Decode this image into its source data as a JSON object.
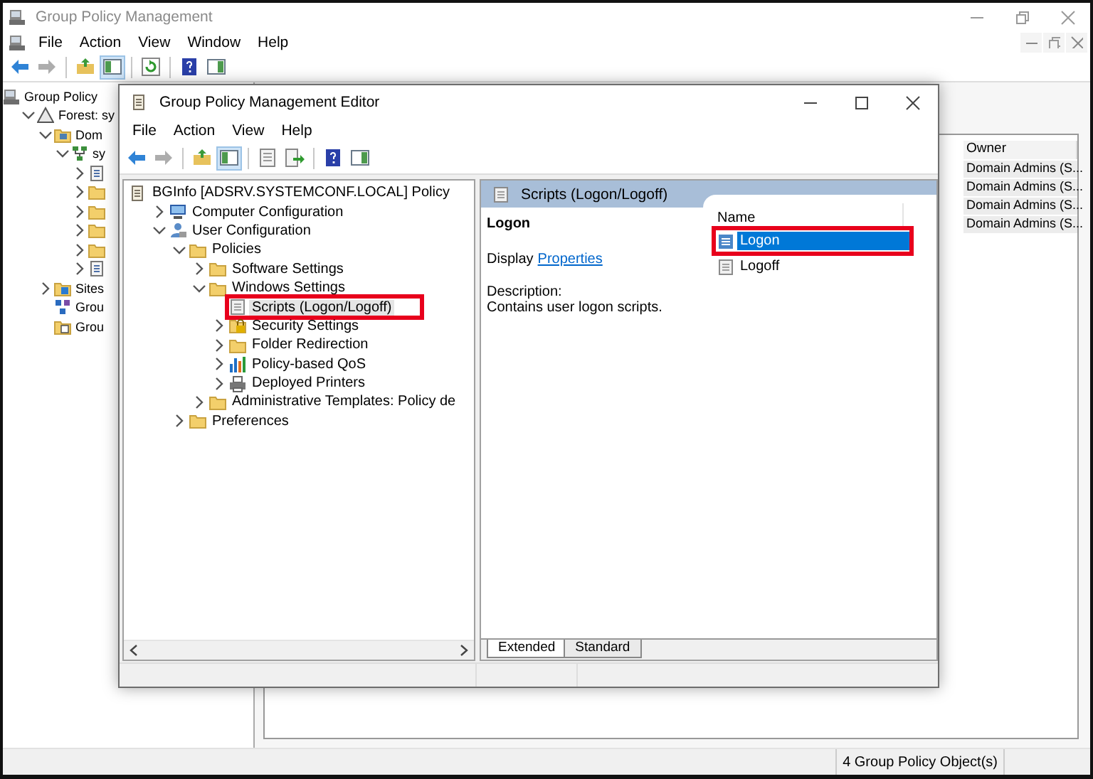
{
  "main_window": {
    "title": "Group Policy Management",
    "menu": [
      "File",
      "Action",
      "View",
      "Window",
      "Help"
    ],
    "toolbar": [
      {
        "kind": "back",
        "disabled": false,
        "on": false
      },
      {
        "kind": "forward",
        "disabled": true,
        "on": false
      },
      {
        "kind": "separator"
      },
      {
        "kind": "up",
        "disabled": false,
        "on": false
      },
      {
        "kind": "tree",
        "disabled": false,
        "on": true
      },
      {
        "kind": "separator"
      },
      {
        "kind": "refresh",
        "disabled": false,
        "on": false
      },
      {
        "kind": "separator"
      },
      {
        "kind": "help",
        "disabled": false,
        "on": false
      },
      {
        "kind": "view",
        "disabled": false,
        "on": false
      }
    ],
    "tree": [
      {
        "label": "Group Policy",
        "kind": "console",
        "children": [
          {
            "label": "Forest: sy",
            "kind": "forest",
            "expanded": true,
            "children": [
              {
                "label": "Dom",
                "kind": "domains",
                "expanded": true,
                "children": [
                  {
                    "label": "sy",
                    "kind": "domain",
                    "expanded": true,
                    "children": [
                      {
                        "kind": "gpo",
                        "expanded": false
                      },
                      {
                        "kind": "folder",
                        "expanded": false
                      },
                      {
                        "kind": "folder",
                        "expanded": false
                      },
                      {
                        "kind": "folder",
                        "expanded": false
                      },
                      {
                        "kind": "folder",
                        "expanded": false
                      },
                      {
                        "kind": "gpo",
                        "expanded": false
                      }
                    ]
                  }
                ]
              },
              {
                "label": "Sites",
                "kind": "sites",
                "expanded": false
              },
              {
                "label": "Grou",
                "kind": "modeling"
              },
              {
                "label": "Grou",
                "kind": "results"
              }
            ]
          }
        ]
      }
    ],
    "table": {
      "columns": [
        "Owner"
      ],
      "rows": [
        [
          "Domain Admins (S..."
        ],
        [
          "Domain Admins (S..."
        ],
        [
          "Domain Admins (S..."
        ],
        [
          "Domain Admins (S..."
        ]
      ]
    },
    "status_bar": "4 Group Policy Object(s)"
  },
  "editor_window": {
    "title": "Group Policy Management Editor",
    "menu": [
      "File",
      "Action",
      "View",
      "Help"
    ],
    "toolbar": [
      {
        "kind": "back",
        "disabled": false,
        "on": false
      },
      {
        "kind": "forward",
        "disabled": true,
        "on": false
      },
      {
        "kind": "separator"
      },
      {
        "kind": "up",
        "disabled": false,
        "on": false
      },
      {
        "kind": "tree",
        "disabled": false,
        "on": true
      },
      {
        "kind": "separator"
      },
      {
        "kind": "list",
        "disabled": false,
        "on": false
      },
      {
        "kind": "export",
        "disabled": false,
        "on": false
      },
      {
        "kind": "separator"
      },
      {
        "kind": "help",
        "disabled": false,
        "on": false
      },
      {
        "kind": "view",
        "disabled": false,
        "on": false
      }
    ],
    "tree": [
      {
        "label": "BGInfo [ADSRV.SYSTEMCONF.LOCAL] Policy",
        "kind": "policy",
        "selected": false,
        "annotated": false,
        "children": [
          {
            "label": "Computer Configuration",
            "kind": "computer",
            "expanded": false,
            "selected": false,
            "annotated": false
          },
          {
            "label": "User Configuration",
            "kind": "user",
            "expanded": true,
            "selected": false,
            "annotated": false,
            "children": [
              {
                "label": "Policies",
                "kind": "folder",
                "expanded": true,
                "selected": false,
                "annotated": false,
                "children": [
                  {
                    "label": "Software Settings",
                    "kind": "folder",
                    "expanded": false,
                    "selected": false,
                    "annotated": false
                  },
                  {
                    "label": "Windows Settings",
                    "kind": "folder",
                    "expanded": true,
                    "selected": false,
                    "annotated": false,
                    "children": [
                      {
                        "label": "Scripts (Logon/Logoff)",
                        "kind": "scripts",
                        "selected": true,
                        "annotated": true
                      },
                      {
                        "label": "Security Settings",
                        "kind": "security",
                        "expanded": false,
                        "selected": false,
                        "annotated": false
                      },
                      {
                        "label": "Folder Redirection",
                        "kind": "folder",
                        "expanded": false,
                        "selected": false,
                        "annotated": false
                      },
                      {
                        "label": "Policy-based QoS",
                        "kind": "qos",
                        "expanded": false,
                        "selected": false,
                        "annotated": false
                      },
                      {
                        "label": "Deployed Printers",
                        "kind": "printer",
                        "expanded": false,
                        "selected": false,
                        "annotated": false
                      }
                    ]
                  },
                  {
                    "label": "Administrative Templates: Policy de",
                    "kind": "folder",
                    "expanded": false,
                    "selected": false,
                    "annotated": false
                  }
                ]
              },
              {
                "label": "Preferences",
                "kind": "folder",
                "expanded": false,
                "selected": false,
                "annotated": false
              }
            ]
          }
        ]
      }
    ],
    "detail": {
      "header": "Scripts (Logon/Logoff)",
      "item_title": "Logon",
      "display_label": "Display",
      "display_link": "Properties",
      "description_label": "Description:",
      "description": "Contains user logon scripts.",
      "list": {
        "columns": [
          "Name"
        ],
        "items": [
          {
            "label": "Logon",
            "kind": "script-active",
            "selected": true,
            "annotated": true
          },
          {
            "label": "Logoff",
            "kind": "script",
            "selected": false,
            "annotated": false
          }
        ]
      }
    },
    "tabs": [
      {
        "label": "Extended",
        "selected": true
      },
      {
        "label": "Standard",
        "selected": false
      }
    ]
  }
}
